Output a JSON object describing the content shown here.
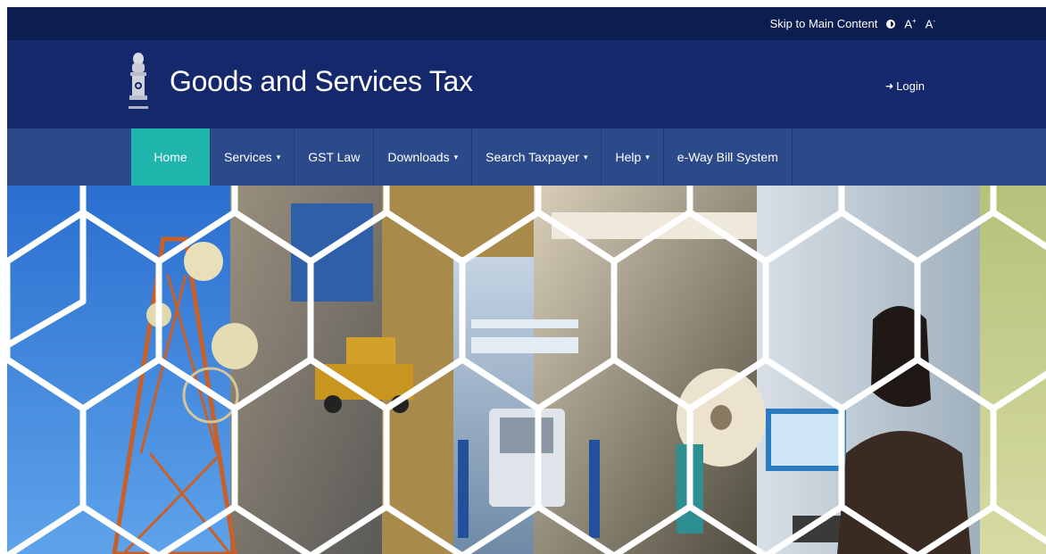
{
  "utility": {
    "skip_label": "Skip to Main Content",
    "font_increase": "A",
    "font_increase_sup": "+",
    "font_decrease": "A",
    "font_decrease_sup": "-"
  },
  "header": {
    "title": "Goods and Services Tax",
    "login_label": "Login"
  },
  "nav": {
    "items": [
      {
        "label": "Home",
        "dropdown": false
      },
      {
        "label": "Services",
        "dropdown": true
      },
      {
        "label": "GST Law",
        "dropdown": false
      },
      {
        "label": "Downloads",
        "dropdown": true
      },
      {
        "label": "Search Taxpayer",
        "dropdown": true
      },
      {
        "label": "Help",
        "dropdown": true
      },
      {
        "label": "e-Way Bill System",
        "dropdown": false
      }
    ],
    "caret": "▾"
  },
  "colors": {
    "utility_bg": "#0c1d4f",
    "header_bg": "#16286c",
    "nav_bg": "#2c4a8a",
    "active_tab": "#1fb5ad"
  },
  "icons": {
    "contrast": "contrast-icon",
    "login": "sign-in-icon",
    "emblem": "national-emblem-icon"
  }
}
